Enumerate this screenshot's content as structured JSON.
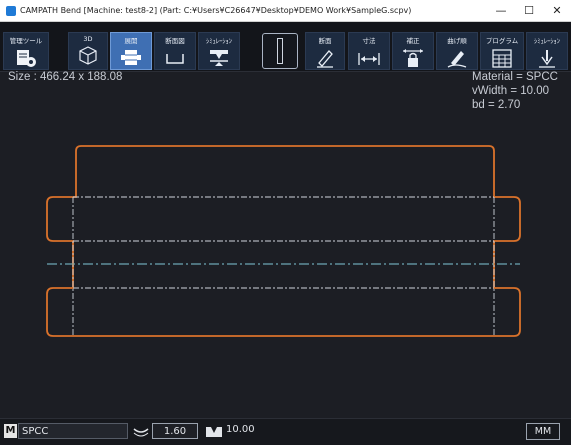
{
  "window": {
    "title": "CAMPATH Bend  [Machine: test8-2]  (Part: C:¥Users¥C26647¥Desktop¥DEMO Work¥SampleG.scpv)",
    "minimize": "—",
    "maximize": "☐",
    "close": "✕"
  },
  "toolbar": {
    "buttons": [
      {
        "label": "管理ツール",
        "icon": "management-tool-icon"
      },
      {
        "label": "3D",
        "icon": "3d-cube-icon"
      },
      {
        "label": "展開",
        "icon": "unfold-icon",
        "active": true
      },
      {
        "label": "断面図",
        "icon": "cross-section-icon"
      },
      {
        "label": "ｼﾐｭﾚｰｼｮﾝ",
        "icon": "press-simulation-icon"
      },
      {
        "label": "断面",
        "icon": "pencil-icon"
      },
      {
        "label": "寸法",
        "icon": "dimension-arrow-icon"
      },
      {
        "label": "補正",
        "icon": "correction-lock-icon"
      },
      {
        "label": "曲げ順",
        "icon": "bend-order-icon"
      },
      {
        "label": "プログラム",
        "icon": "program-grid-icon"
      },
      {
        "label": "ｼﾐｭﾚｰｼｮﾝ",
        "icon": "simulation-tool-icon"
      }
    ],
    "view_icon": "single-view-icon"
  },
  "info": {
    "size": "Size : 466.24 x 188.08",
    "material": "Material = SPCC",
    "vwidth": "vWidth = 10.00",
    "bd": "bd = 2.70"
  },
  "status": {
    "mode": "M",
    "material": "SPCC",
    "thickness": "1.60",
    "vwidth": "10.00",
    "unit": "MM"
  },
  "colors": {
    "outline": "#d9722b",
    "bendline": "#cfd4dc",
    "centerline": "#7fc8d8",
    "active": "#3f6fb3"
  }
}
